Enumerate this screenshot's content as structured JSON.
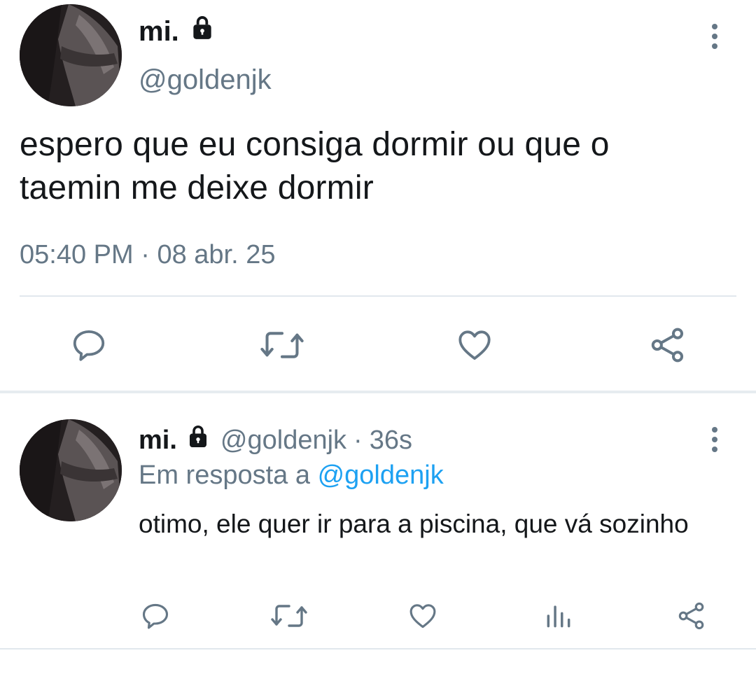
{
  "tweet": {
    "author_name": "mi.",
    "author_handle": "@goldenjk",
    "text": "espero que eu consiga dormir ou que o taemin me deixe dormir",
    "time": "05:40 PM",
    "separator": "·",
    "date": "08 abr. 25",
    "actions": [
      "reply-icon",
      "retweet-icon",
      "like-icon",
      "share-icon"
    ]
  },
  "reply": {
    "author_name": "mi.",
    "author_handle": "@goldenjk",
    "separator": "·",
    "age": "36s",
    "in_reply_to_prefix": "Em resposta a",
    "in_reply_to_handle": "@goldenjk",
    "text": "otimo, ele quer ir para a piscina, que vá sozinho",
    "actions": [
      "reply-icon",
      "retweet-icon",
      "like-icon",
      "analytics-icon",
      "share-icon"
    ]
  },
  "colors": {
    "text": "#14171a",
    "secondary": "#657786",
    "link": "#1da1f2",
    "divider": "#e1e8ed"
  }
}
